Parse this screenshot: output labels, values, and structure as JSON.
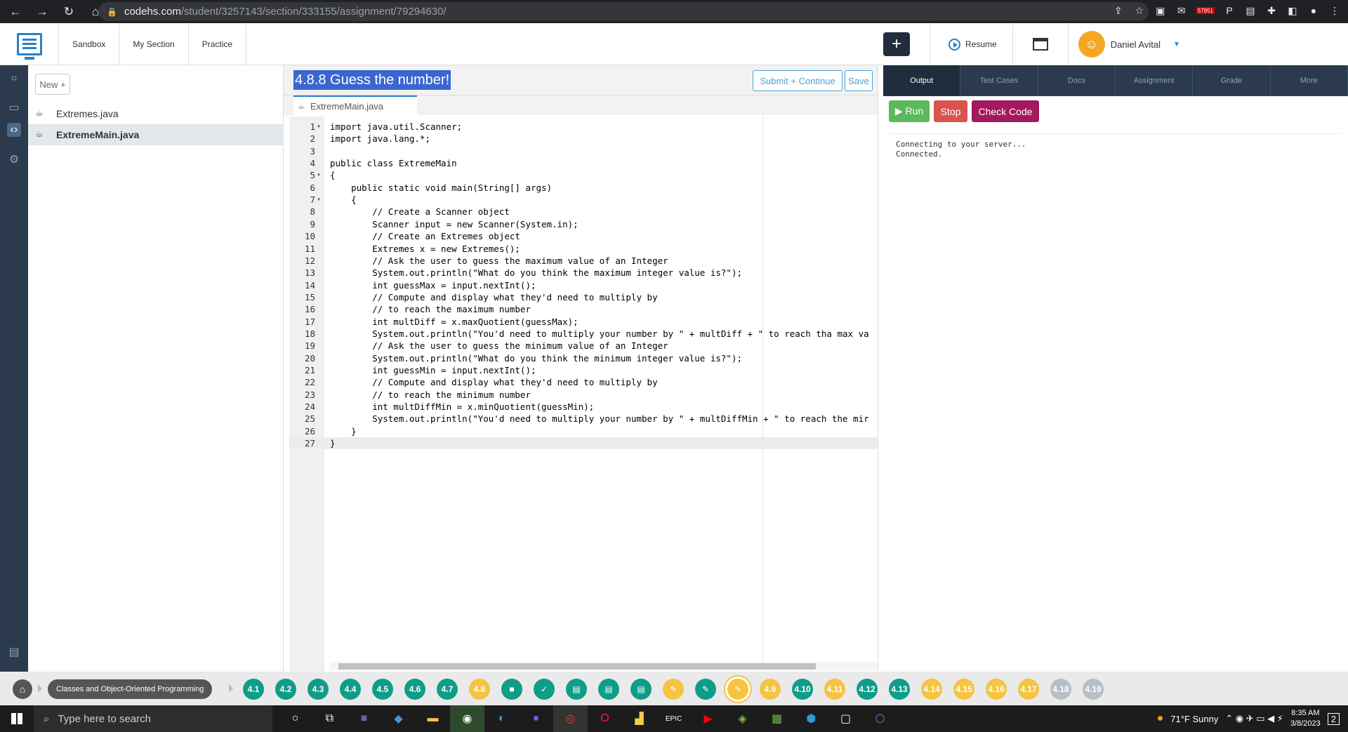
{
  "browser": {
    "url_host": "codehs.com",
    "url_path": "/student/3257143/section/333155/assignment/79294630/",
    "extension_badge": "57951"
  },
  "topnav": {
    "links": [
      "Sandbox",
      "My Section",
      "Practice"
    ],
    "resume_label": "Resume",
    "user_name": "Daniel Avital"
  },
  "files": {
    "new_label": "New +",
    "items": [
      {
        "name": "Extremes.java",
        "selected": false
      },
      {
        "name": "ExtremeMain.java",
        "selected": true
      }
    ]
  },
  "editor": {
    "title": "4.8.8 Guess the number!",
    "submit_label": "Submit + Continue",
    "save_label": "Save",
    "tab_name": "ExtremeMain.java",
    "lines": [
      {
        "n": "1",
        "fold": "▾",
        "text": "import java.util.Scanner;",
        "type": "code"
      },
      {
        "n": "2",
        "fold": "",
        "text": "import java.lang.*;",
        "type": "code"
      },
      {
        "n": "3",
        "fold": "",
        "text": "",
        "type": "code"
      },
      {
        "n": "4",
        "fold": "",
        "text": "public class ExtremeMain",
        "type": "code"
      },
      {
        "n": "5",
        "fold": "▾",
        "text": "{",
        "type": "code"
      },
      {
        "n": "6",
        "fold": "",
        "text": "    public static void main(String[] args)",
        "type": "code"
      },
      {
        "n": "7",
        "fold": "▾",
        "text": "    {",
        "type": "code"
      },
      {
        "n": "8",
        "fold": "",
        "text": "        // Create a Scanner object",
        "type": "comment"
      },
      {
        "n": "9",
        "fold": "",
        "text": "        Scanner input = new Scanner(System.in);",
        "type": "code"
      },
      {
        "n": "10",
        "fold": "",
        "text": "        // Create an Extremes object",
        "type": "comment"
      },
      {
        "n": "11",
        "fold": "",
        "text": "        Extremes x = new Extremes();",
        "type": "code"
      },
      {
        "n": "12",
        "fold": "",
        "text": "        // Ask the user to guess the maximum value of an Integer",
        "type": "comment"
      },
      {
        "n": "13",
        "fold": "",
        "text": "        System.out.println(\"What do you think the maximum integer value is?\");",
        "type": "string"
      },
      {
        "n": "14",
        "fold": "",
        "text": "        int guessMax = input.nextInt();",
        "type": "code"
      },
      {
        "n": "15",
        "fold": "",
        "text": "        // Compute and display what they'd need to multiply by",
        "type": "comment"
      },
      {
        "n": "16",
        "fold": "",
        "text": "        // to reach the maximum number",
        "type": "comment"
      },
      {
        "n": "17",
        "fold": "",
        "text": "        int multDiff = x.maxQuotient(guessMax);",
        "type": "code"
      },
      {
        "n": "18",
        "fold": "",
        "text": "        System.out.println(\"You'd need to multiply your number by \" + multDiff + \" to reach tha max va",
        "type": "string"
      },
      {
        "n": "19",
        "fold": "",
        "text": "        // Ask the user to guess the minimum value of an Integer",
        "type": "comment"
      },
      {
        "n": "20",
        "fold": "",
        "text": "        System.out.println(\"What do you think the minimum integer value is?\");",
        "type": "string"
      },
      {
        "n": "21",
        "fold": "",
        "text": "        int guessMin = input.nextInt();",
        "type": "code"
      },
      {
        "n": "22",
        "fold": "",
        "text": "        // Compute and display what they'd need to multiply by",
        "type": "comment"
      },
      {
        "n": "23",
        "fold": "",
        "text": "        // to reach the minimum number",
        "type": "comment"
      },
      {
        "n": "24",
        "fold": "",
        "text": "        int multDiffMin = x.minQuotient(guessMin);",
        "type": "code"
      },
      {
        "n": "25",
        "fold": "",
        "text": "        System.out.println(\"You'd need to multiply your number by \" + multDiffMin + \" to reach the mir",
        "type": "string"
      },
      {
        "n": "26",
        "fold": "",
        "text": "    }",
        "type": "code"
      },
      {
        "n": "27",
        "fold": "",
        "text": "}",
        "type": "code",
        "active": true
      }
    ]
  },
  "output_panel": {
    "tabs": [
      "Output",
      "Test Cases",
      "Docs",
      "Assignment",
      "Grade",
      "More"
    ],
    "active_tab": "Output",
    "run_label": "▶ Run",
    "stop_label": "Stop",
    "check_label": "Check Code",
    "console_text": "Connecting to your server...\nConnected."
  },
  "modules": {
    "crumb": "Classes and Object-Oriented Programming",
    "items": [
      {
        "label": "4.1",
        "state": "done"
      },
      {
        "label": "4.2",
        "state": "done"
      },
      {
        "label": "4.3",
        "state": "done"
      },
      {
        "label": "4.4",
        "state": "done"
      },
      {
        "label": "4.5",
        "state": "done"
      },
      {
        "label": "4.6",
        "state": "done"
      },
      {
        "label": "4.7",
        "state": "done"
      },
      {
        "label": "4.8",
        "state": "current"
      },
      {
        "label": "",
        "state": "done",
        "icon": "video-icon"
      },
      {
        "label": "",
        "state": "done",
        "icon": "check-icon"
      },
      {
        "label": "",
        "state": "done",
        "icon": "doc-icon"
      },
      {
        "label": "",
        "state": "done",
        "icon": "doc-icon"
      },
      {
        "label": "",
        "state": "done",
        "icon": "doc-icon"
      },
      {
        "label": "",
        "state": "current",
        "icon": "pencil-icon"
      },
      {
        "label": "",
        "state": "done",
        "icon": "pencil-icon"
      },
      {
        "label": "",
        "state": "current",
        "icon": "pencil-icon"
      },
      {
        "label": "4.9",
        "state": "current"
      },
      {
        "label": "4.10",
        "state": "done"
      },
      {
        "label": "4.11",
        "state": "current"
      },
      {
        "label": "4.12",
        "state": "done"
      },
      {
        "label": "4.13",
        "state": "done"
      },
      {
        "label": "4.14",
        "state": "current"
      },
      {
        "label": "4.15",
        "state": "current"
      },
      {
        "label": "4.16",
        "state": "current"
      },
      {
        "label": "4.17",
        "state": "current"
      },
      {
        "label": "4.18",
        "state": "locked"
      },
      {
        "label": "4.19",
        "state": "locked"
      }
    ]
  },
  "taskbar": {
    "search_placeholder": "Type here to search",
    "weather": "71°F  Sunny",
    "time": "8:35 AM",
    "date": "3/8/2023",
    "notifications": "2"
  },
  "colors": {
    "accent": "#2a7fc9",
    "run": "#5cb85c",
    "stop": "#d9534f",
    "check": "#a3195b",
    "module_done": "#0f9d8a",
    "module_current": "#f6c343",
    "module_locked": "#b5bfc9"
  }
}
